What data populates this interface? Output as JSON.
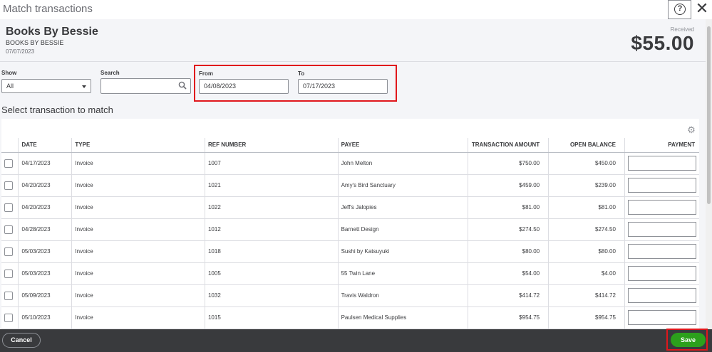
{
  "window": {
    "title": "Match transactions",
    "help_icon": "question-circle-icon",
    "close_icon": "close-icon",
    "help_glyph": "?",
    "close_glyph": "✕"
  },
  "header": {
    "payee_name": "Books By Bessie",
    "payee_sub": "BOOKS BY BESSIE",
    "date": "07/07/2023",
    "received_label": "Received",
    "amount": "$55.00"
  },
  "filters": {
    "show_label": "Show",
    "show_value": "All",
    "search_label": "Search",
    "search_value": "",
    "from_label": "From",
    "from_value": "04/08/2023",
    "to_label": "To",
    "to_value": "07/17/2023"
  },
  "section_heading": "Select transaction to match",
  "table": {
    "gear_glyph": "⚙",
    "columns": [
      "DATE",
      "TYPE",
      "REF NUMBER",
      "PAYEE",
      "TRANSACTION AMOUNT",
      "OPEN BALANCE",
      "PAYMENT"
    ],
    "rows": [
      {
        "date": "04/17/2023",
        "type": "Invoice",
        "ref": "1007",
        "payee": "John Melton",
        "amount": "$750.00",
        "balance": "$450.00"
      },
      {
        "date": "04/20/2023",
        "type": "Invoice",
        "ref": "1021",
        "payee": "Amy's Bird Sanctuary",
        "amount": "$459.00",
        "balance": "$239.00"
      },
      {
        "date": "04/20/2023",
        "type": "Invoice",
        "ref": "1022",
        "payee": "Jeff's Jalopies",
        "amount": "$81.00",
        "balance": "$81.00"
      },
      {
        "date": "04/28/2023",
        "type": "Invoice",
        "ref": "1012",
        "payee": "Barnett Design",
        "amount": "$274.50",
        "balance": "$274.50"
      },
      {
        "date": "05/03/2023",
        "type": "Invoice",
        "ref": "1018",
        "payee": "Sushi by Katsuyuki",
        "amount": "$80.00",
        "balance": "$80.00"
      },
      {
        "date": "05/03/2023",
        "type": "Invoice",
        "ref": "1005",
        "payee": "55 Twin Lane",
        "amount": "$54.00",
        "balance": "$4.00"
      },
      {
        "date": "05/09/2023",
        "type": "Invoice",
        "ref": "1032",
        "payee": "Travis Waldron",
        "amount": "$414.72",
        "balance": "$414.72"
      },
      {
        "date": "05/10/2023",
        "type": "Invoice",
        "ref": "1015",
        "payee": "Paulsen Medical Supplies",
        "amount": "$954.75",
        "balance": "$954.75"
      }
    ]
  },
  "footer": {
    "cancel_label": "Cancel",
    "save_label": "Save"
  },
  "colors": {
    "accent_green": "#2ca01c",
    "highlight_red": "#e0171c",
    "footer_bg": "#393a3d"
  }
}
